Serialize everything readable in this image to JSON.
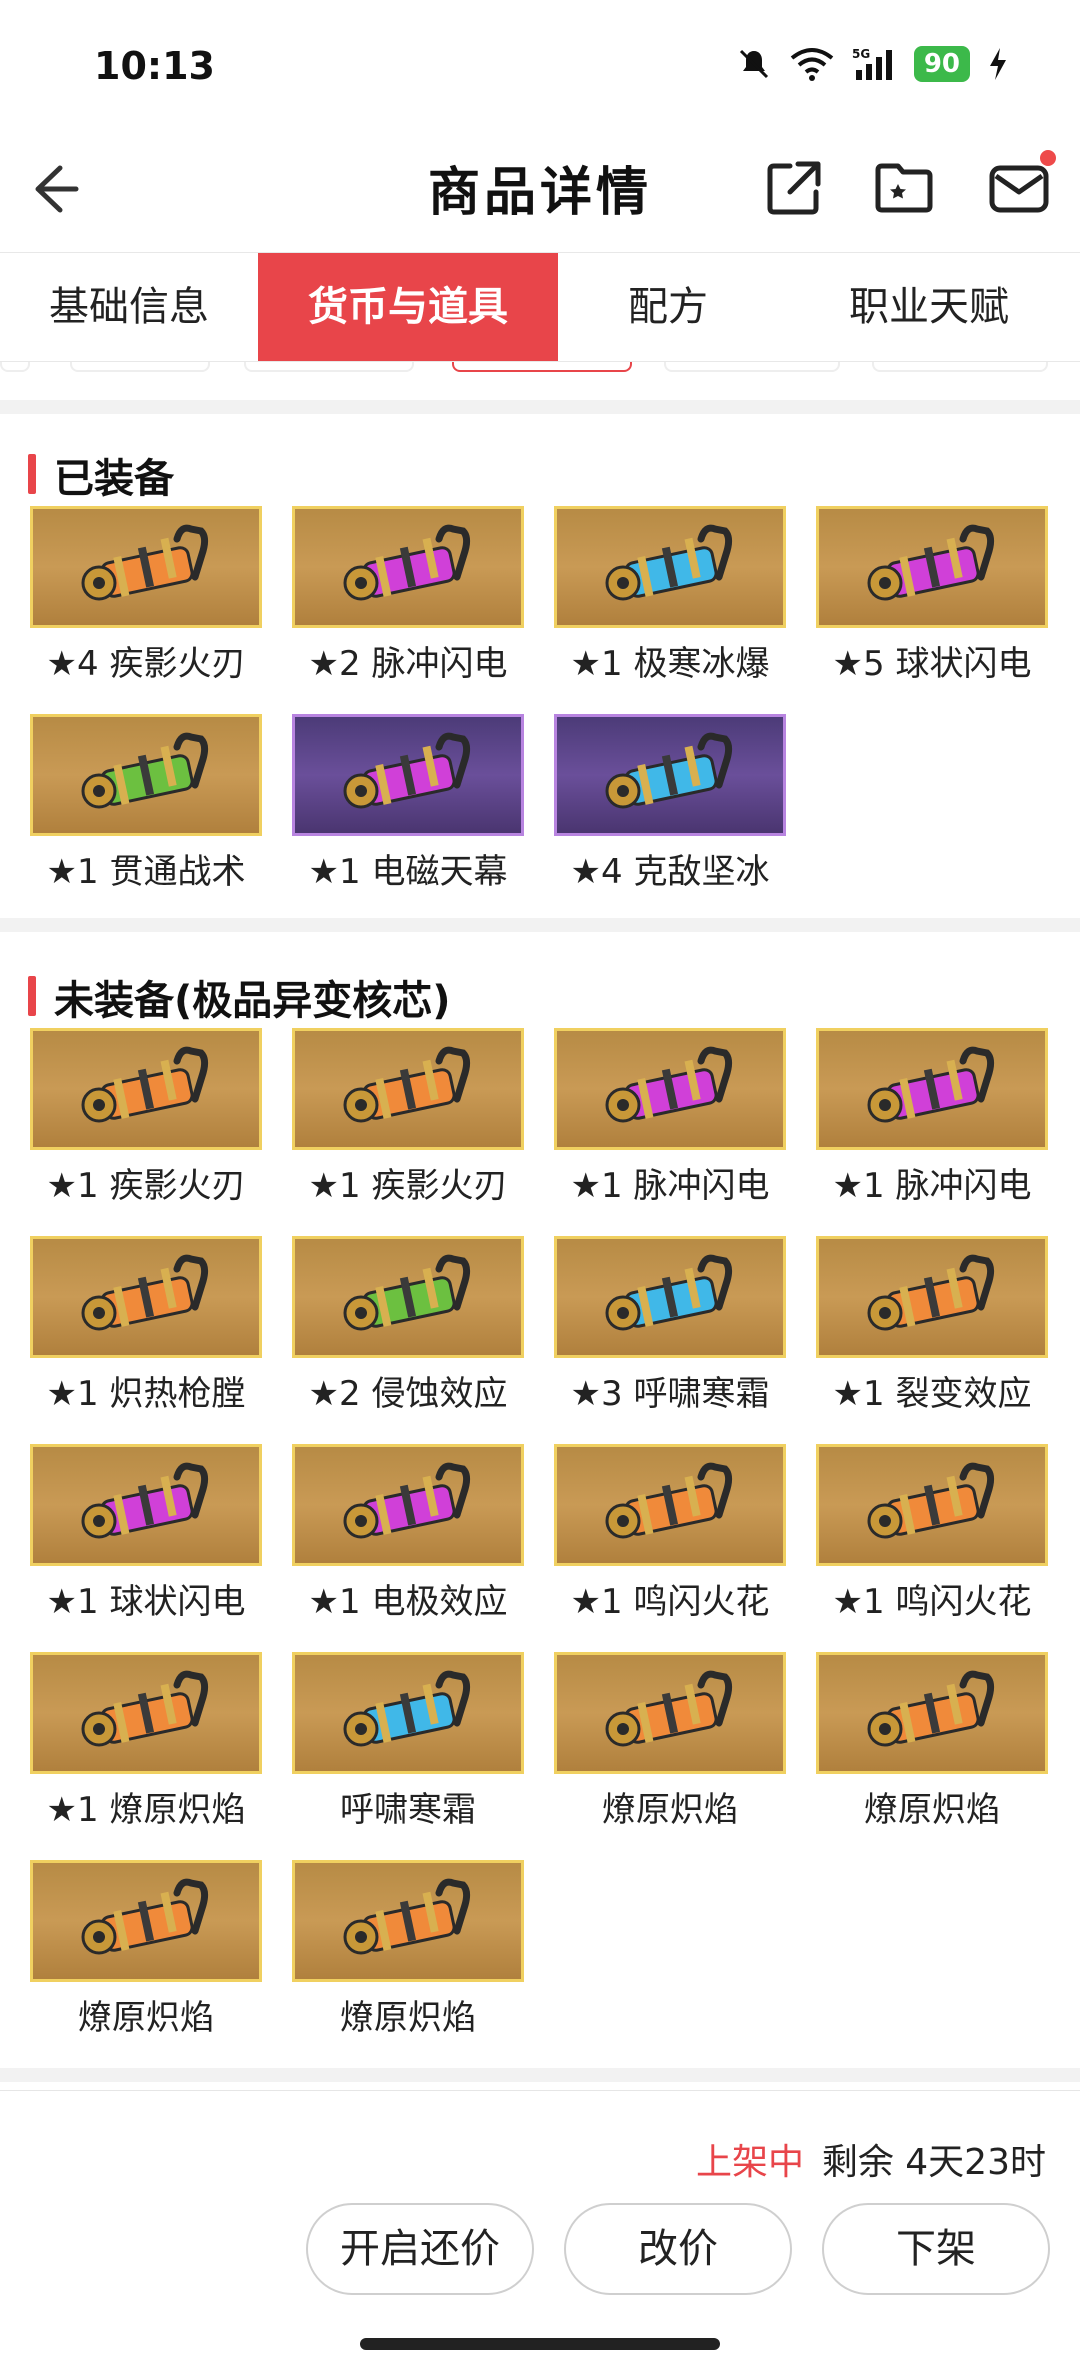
{
  "status_bar": {
    "time": "10:13",
    "battery": "90",
    "network": "5G"
  },
  "header": {
    "title": "商品详情"
  },
  "tabs": [
    {
      "label": "基础信息",
      "active": false
    },
    {
      "label": "货币与道具",
      "active": true
    },
    {
      "label": "配方",
      "active": false
    },
    {
      "label": "职业天赋",
      "active": false
    }
  ],
  "equipped": {
    "title": "已装备",
    "items": [
      {
        "label": "★4 疾影火刃",
        "color": "orange",
        "frame": "gold"
      },
      {
        "label": "★2 脉冲闪电",
        "color": "magenta",
        "frame": "gold"
      },
      {
        "label": "★1 极寒冰爆",
        "color": "cyan",
        "frame": "gold"
      },
      {
        "label": "★5 球状闪电",
        "color": "magenta",
        "frame": "gold"
      },
      {
        "label": "★1 贯通战术",
        "color": "green",
        "frame": "gold"
      },
      {
        "label": "★1 电磁天幕",
        "color": "magenta",
        "frame": "purple"
      },
      {
        "label": "★4 克敌坚冰",
        "color": "cyan",
        "frame": "purple"
      }
    ]
  },
  "unequipped": {
    "title": "未装备(极品异变核芯)",
    "items": [
      {
        "label": "★1 疾影火刃",
        "color": "orange",
        "frame": "gold"
      },
      {
        "label": "★1 疾影火刃",
        "color": "orange",
        "frame": "gold"
      },
      {
        "label": "★1 脉冲闪电",
        "color": "magenta",
        "frame": "gold"
      },
      {
        "label": "★1 脉冲闪电",
        "color": "magenta",
        "frame": "gold"
      },
      {
        "label": "★1 炽热枪膛",
        "color": "orange",
        "frame": "gold"
      },
      {
        "label": "★2 侵蚀效应",
        "color": "green",
        "frame": "gold"
      },
      {
        "label": "★3 呼啸寒霜",
        "color": "cyan",
        "frame": "gold"
      },
      {
        "label": "★1 裂变效应",
        "color": "orange",
        "frame": "gold"
      },
      {
        "label": "★1 球状闪电",
        "color": "magenta",
        "frame": "gold"
      },
      {
        "label": "★1 电极效应",
        "color": "magenta",
        "frame": "gold"
      },
      {
        "label": "★1 鸣闪火花",
        "color": "orange",
        "frame": "gold"
      },
      {
        "label": "★1 鸣闪火花",
        "color": "orange",
        "frame": "gold"
      },
      {
        "label": "★1 燎原炽焰",
        "color": "orange",
        "frame": "gold"
      },
      {
        "label": "呼啸寒霜",
        "color": "cyan",
        "frame": "gold"
      },
      {
        "label": "燎原炽焰",
        "color": "orange",
        "frame": "gold"
      },
      {
        "label": "燎原炽焰",
        "color": "orange",
        "frame": "gold"
      },
      {
        "label": "燎原炽焰",
        "color": "orange",
        "frame": "gold"
      },
      {
        "label": "燎原炽焰",
        "color": "orange",
        "frame": "gold"
      }
    ]
  },
  "bottom": {
    "status": "上架中",
    "remaining": "剩余 4天23时",
    "buttons": {
      "counter_offer": "开启还价",
      "change_price": "改价",
      "delist": "下架"
    }
  },
  "colors": {
    "accent": "#e8454a",
    "orange": "#f08a3a",
    "magenta": "#d040d8",
    "cyan": "#40b8e8",
    "green": "#6cc040"
  }
}
